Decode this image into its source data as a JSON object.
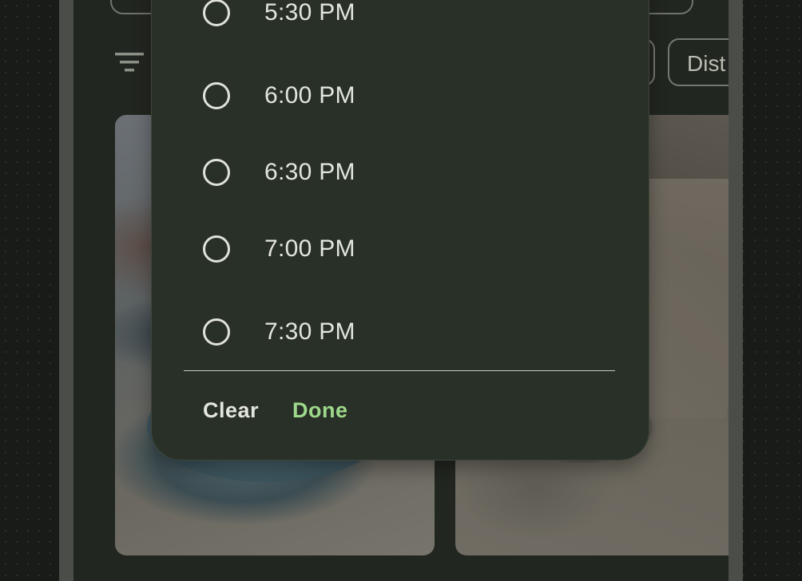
{
  "background": {
    "filter_chip_visible_label": "Dist"
  },
  "time_picker": {
    "options": [
      {
        "label": "5:30 PM",
        "selected": false
      },
      {
        "label": "6:00 PM",
        "selected": false
      },
      {
        "label": "6:30 PM",
        "selected": false
      },
      {
        "label": "7:00 PM",
        "selected": false
      },
      {
        "label": "7:30 PM",
        "selected": false
      }
    ],
    "clear_label": "Clear",
    "done_label": "Done"
  },
  "colors": {
    "accent": "#9ed98b",
    "dialog_surface": "#293027",
    "scrim_screen": "#222620"
  },
  "icons": {
    "filter": "filter-icon",
    "radio": "radio-unchecked-icon"
  }
}
